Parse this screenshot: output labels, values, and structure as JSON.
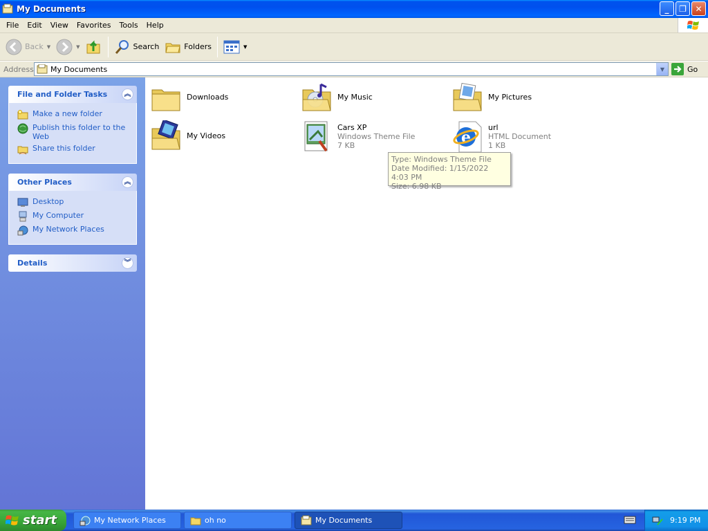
{
  "window": {
    "title": "My Documents"
  },
  "menu": [
    "File",
    "Edit",
    "View",
    "Favorites",
    "Tools",
    "Help"
  ],
  "toolbar": {
    "back": "Back",
    "search": "Search",
    "folders": "Folders"
  },
  "address": {
    "label": "Address",
    "value": "My Documents",
    "go": "Go"
  },
  "panels": {
    "file_tasks": {
      "title": "File and Folder Tasks",
      "items": [
        "Make a new folder",
        "Publish this folder to the Web",
        "Share this folder"
      ]
    },
    "other_places": {
      "title": "Other Places",
      "items": [
        "Desktop",
        "My Computer",
        "My Network Places"
      ]
    },
    "details": {
      "title": "Details"
    }
  },
  "files": [
    {
      "name": "Downloads"
    },
    {
      "name": "My Music"
    },
    {
      "name": "My Pictures"
    },
    {
      "name": "My Videos"
    },
    {
      "name": "Cars XP",
      "type": "Windows Theme File",
      "size": "7 KB"
    },
    {
      "name": "url",
      "type": "HTML Document",
      "size": "1 KB"
    }
  ],
  "tooltip": {
    "type": "Type: Windows Theme File",
    "modified": "Date Modified: 1/15/2022 4:03 PM",
    "size": "Size: 6.98 KB"
  },
  "taskbar": {
    "start": "start",
    "buttons": [
      "My Network Places",
      "oh no",
      "My Documents"
    ],
    "clock": "9:19 PM"
  },
  "colors": {
    "titlebar": "#0054e3",
    "panel_link": "#215dc6",
    "taskbar": "#245edb",
    "start_green": "#3c9a3c"
  }
}
